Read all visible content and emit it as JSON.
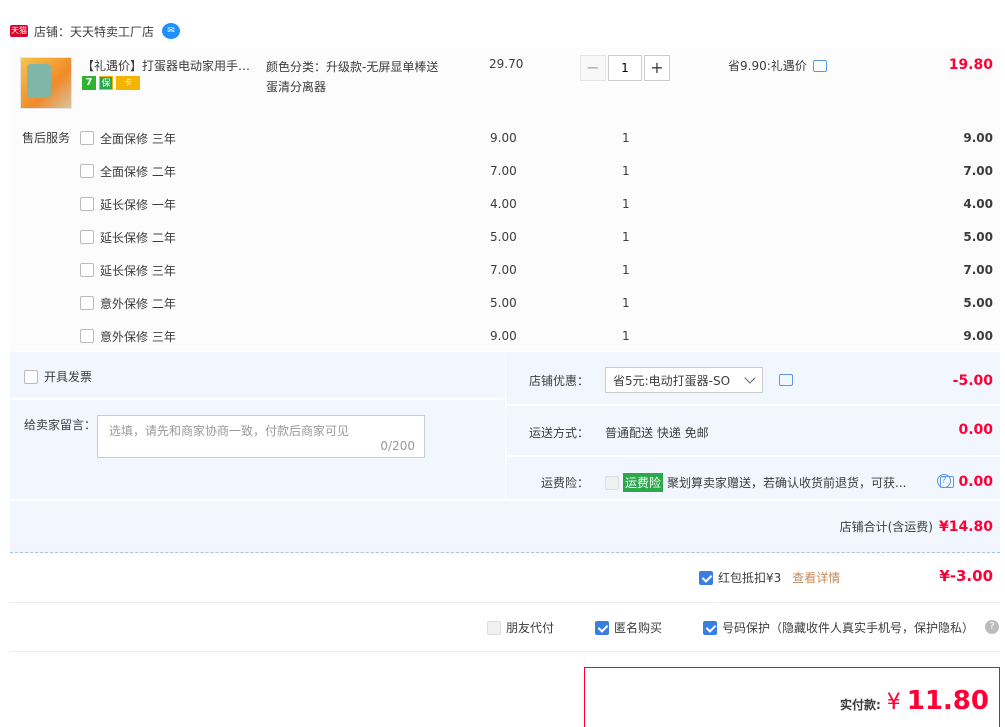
{
  "shop": {
    "tmall_badge": "天猫",
    "name": "店铺：天天特卖工厂店"
  },
  "item": {
    "title": "【礼遇价】打蛋器电动家用手持小型烘焙搅拌器",
    "badges": [
      "7",
      "保",
      "卡"
    ],
    "sku_line1": "颜色分类：升级款-无屏显单棒送",
    "sku_line2": "蛋清分离器",
    "price": "29.70",
    "quantity": "1",
    "minus": "−",
    "plus": "+",
    "saving": "省9.90:礼遇价",
    "total": "19.80"
  },
  "services": {
    "label": "售后服务",
    "rows": [
      {
        "name": "全面保修 三年",
        "price": "9.00",
        "qty": "1",
        "sum": "9.00"
      },
      {
        "name": "全面保修 二年",
        "price": "7.00",
        "qty": "1",
        "sum": "7.00"
      },
      {
        "name": "延长保修 一年",
        "price": "4.00",
        "qty": "1",
        "sum": "4.00"
      },
      {
        "name": "延长保修 二年",
        "price": "5.00",
        "qty": "1",
        "sum": "5.00"
      },
      {
        "name": "延长保修 三年",
        "price": "7.00",
        "qty": "1",
        "sum": "7.00"
      },
      {
        "name": "意外保修 二年",
        "price": "5.00",
        "qty": "1",
        "sum": "5.00"
      },
      {
        "name": "意外保修 三年",
        "price": "9.00",
        "qty": "1",
        "sum": "9.00"
      }
    ]
  },
  "order": {
    "invoice_label": "开具发票",
    "memo_label": "给卖家留言：",
    "memo_placeholder": "选填，请先和商家协商一致，付款后商家可见",
    "memo_count": "0/200",
    "discount_label": "店铺优惠：",
    "discount_value": "省5元:电动打蛋器-SO",
    "discount_amount": "-5.00",
    "shipping_label": "运送方式：",
    "shipping_value": "普通配送 快递 免邮",
    "shipping_amount": "0.00",
    "insurance_label": "运费险：",
    "insurance_tag": "运费险",
    "insurance_text": "聚划算卖家赠送，若确认收货前退货，可获...",
    "insurance_amount": "0.00",
    "subtotal_label": "店铺合计(含运费)",
    "subtotal_value": "¥14.80"
  },
  "redpacket": {
    "label": "红包抵扣¥3",
    "link": "查看详情",
    "amount": "¥-3.00"
  },
  "options": {
    "friend_pay": "朋友代付",
    "anonymous": "匿名购买",
    "phone_protect": "号码保护（隐藏收件人真实手机号，保护隐私）",
    "help": "?"
  },
  "payment": {
    "label": "实付款:",
    "currency": "¥",
    "amount": "11.80"
  },
  "colors": {
    "accent_red": "#ff0036",
    "link_blue": "#3a7ee0",
    "panel_bg": "#f2f7ff"
  }
}
